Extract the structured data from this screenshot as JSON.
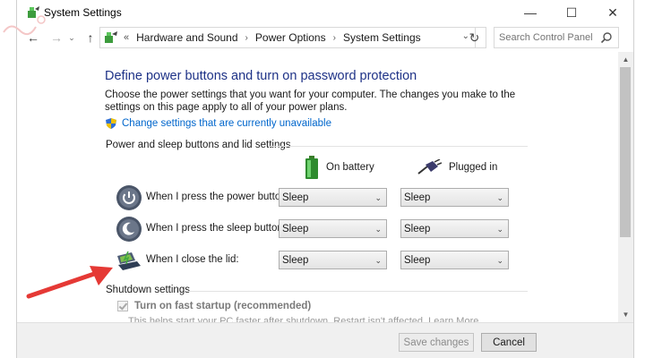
{
  "window": {
    "title": "System Settings",
    "controls": {
      "minimize": "—",
      "maximize": "☐",
      "close": "✕"
    }
  },
  "nav": {
    "back": "←",
    "forward": "→",
    "recent": "⌄",
    "up": "↑",
    "breadcrumbs": [
      "Hardware and Sound",
      "Power Options",
      "System Settings"
    ],
    "overflow": "«",
    "separator": "›",
    "dropdown": "⌄",
    "refresh": "↻",
    "search_placeholder": "Search Control Panel"
  },
  "main": {
    "heading": "Define power buttons and turn on password protection",
    "description": "Choose the power settings that you want for your computer. The changes you make to the settings on this page apply to all of your power plans.",
    "change_link": "Change settings that are currently unavailable",
    "section_power": "Power and sleep buttons and lid settings",
    "col_battery": "On battery",
    "col_plugged": "Plugged in",
    "rows": [
      {
        "label": "When I press the power button:",
        "battery": "Sleep",
        "plugged": "Sleep",
        "icon": "power-button-icon"
      },
      {
        "label": "When I press the sleep button:",
        "battery": "Sleep",
        "plugged": "Sleep",
        "icon": "sleep-button-icon"
      },
      {
        "label": "When I close the lid:",
        "battery": "Sleep",
        "plugged": "Sleep",
        "icon": "laptop-lid-icon"
      }
    ],
    "section_shutdown": "Shutdown settings",
    "fast_startup": "Turn on fast startup (recommended)",
    "fast_startup_checked": true,
    "fast_startup_note": "This helps start your PC faster after shutdown. Restart isn't affected. Learn More"
  },
  "footer": {
    "save": "Save changes",
    "cancel": "Cancel"
  },
  "colors": {
    "heading": "#1e3287",
    "link": "#0066cc",
    "arrow": "#e53935"
  }
}
